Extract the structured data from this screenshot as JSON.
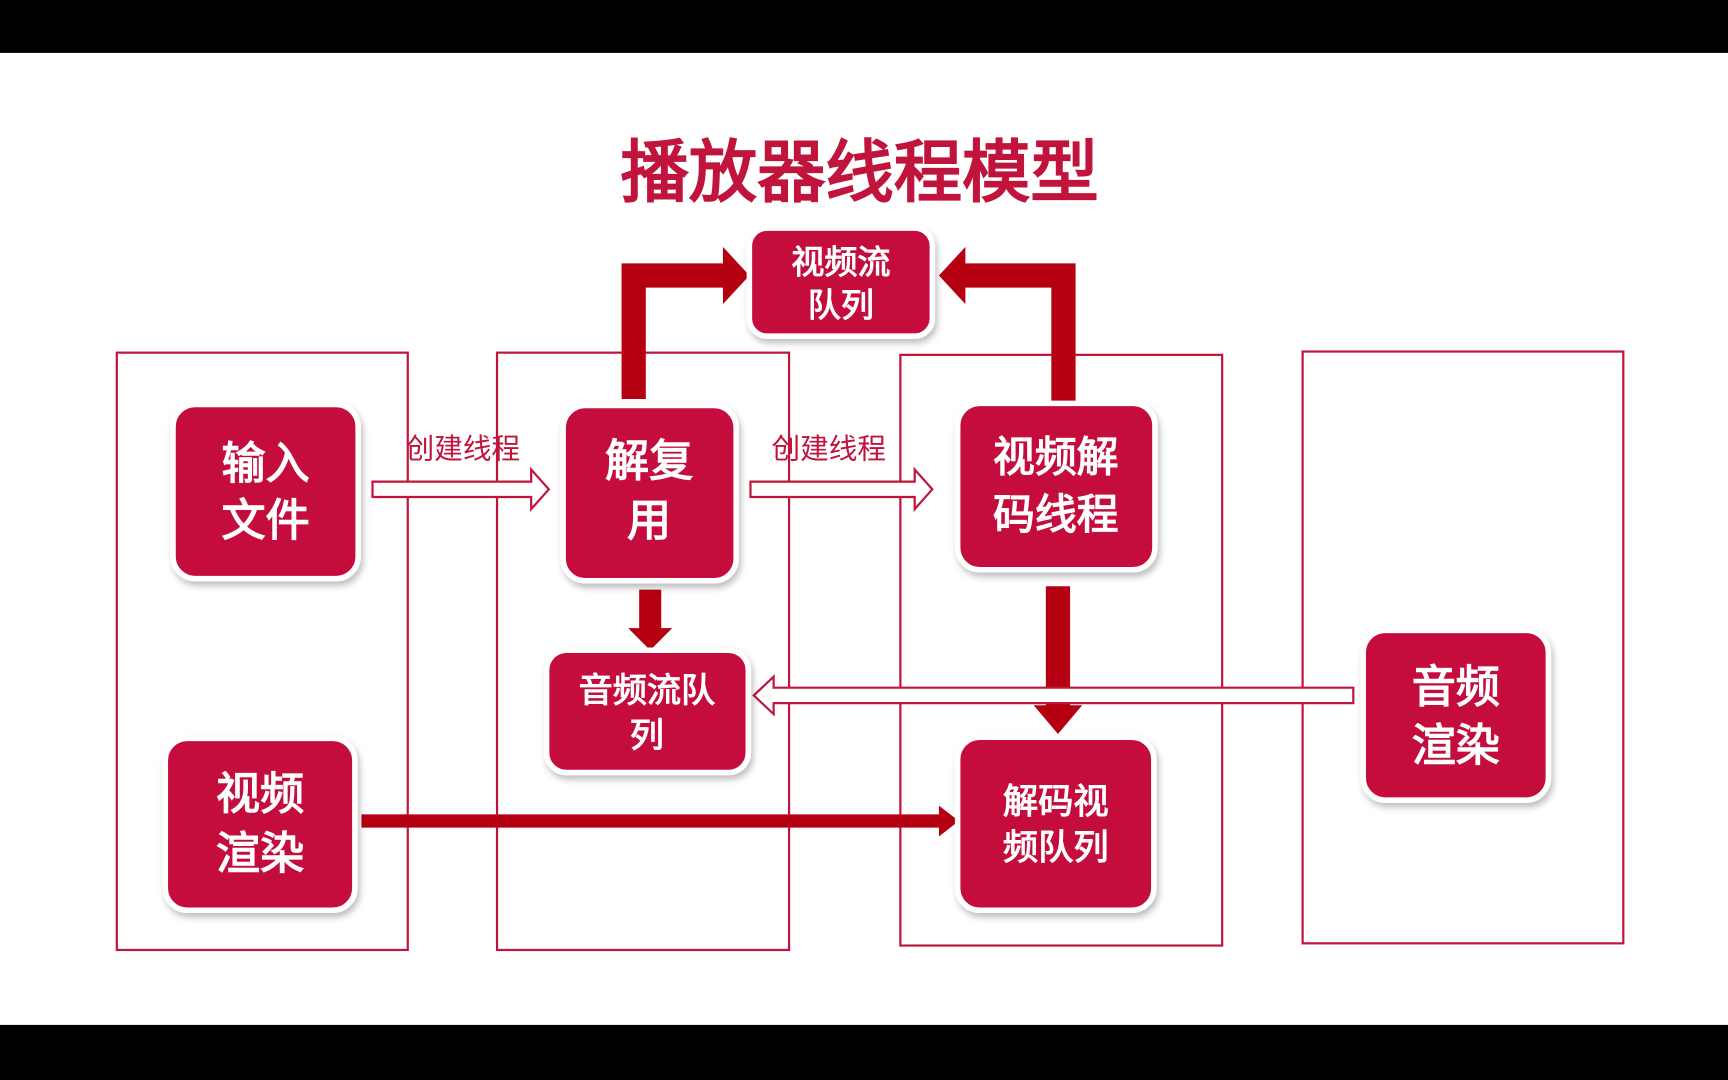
{
  "title": "播放器线程模型",
  "colors": {
    "accent": "#C40C3C",
    "arrow": "#B40010",
    "frame": "#C0143C"
  },
  "boxes": {
    "input_file": [
      "输入",
      "文件"
    ],
    "demux": [
      "解复用",
      "用"
    ],
    "video_stream_queue": [
      "视频流",
      "队列"
    ],
    "video_decode_thread": [
      "视频解",
      "码线程"
    ],
    "audio_stream_queue": [
      "音频流队",
      "列"
    ],
    "video_render": [
      "视频",
      "渲染"
    ],
    "decoded_video_queue": [
      "解码视",
      "频队列"
    ],
    "audio_render": [
      "音频",
      "渲染"
    ]
  },
  "labels": {
    "create_thread_1": "创建线程",
    "create_thread_2": "创建线程"
  }
}
